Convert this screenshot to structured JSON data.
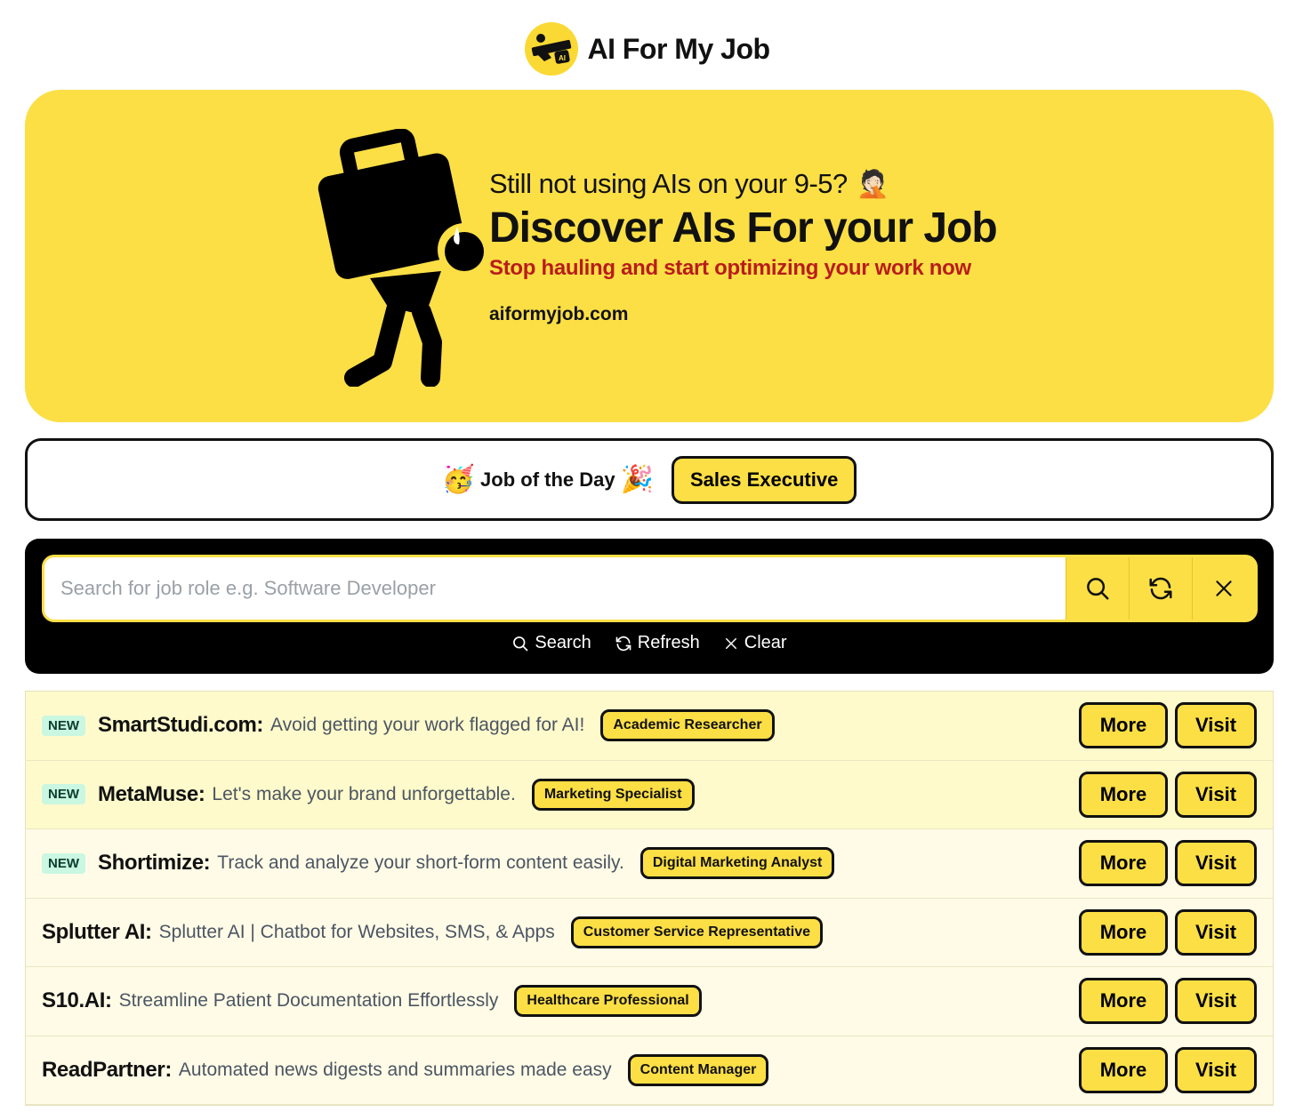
{
  "header": {
    "title": "AI For My Job",
    "logo_icon": "ai-man-carrying-icon"
  },
  "hero": {
    "kicker": "Still not using AIs on your 9-5?",
    "kicker_emoji": "🤦🏻",
    "title": "Discover AIs For your Job",
    "subtitle": "Stop hauling and start optimizing your work now",
    "url": "aiformyjob.com",
    "illustration": "person-carrying-briefcase-icon"
  },
  "job_of_day": {
    "emoji_left": "🥳",
    "label": "Job of the Day",
    "emoji_right": "🎉",
    "job": "Sales Executive"
  },
  "search": {
    "placeholder": "Search for job role e.g. Software Developer",
    "value": "",
    "search_label": "Search",
    "refresh_label": "Refresh",
    "clear_label": "Clear"
  },
  "tools": [
    {
      "is_new": true,
      "badge": "NEW",
      "name": "SmartStudi.com:",
      "desc": "Avoid getting your work flagged for AI!",
      "tag": "Academic Researcher",
      "more": "More",
      "visit": "Visit"
    },
    {
      "is_new": true,
      "badge": "NEW",
      "name": "MetaMuse:",
      "desc": "Let's make your brand unforgettable.",
      "tag": "Marketing Specialist",
      "more": "More",
      "visit": "Visit"
    },
    {
      "is_new": true,
      "badge": "NEW",
      "name": "Shortimize:",
      "desc": "Track and analyze your short-form content easily.",
      "tag": "Digital Marketing Analyst",
      "more": "More",
      "visit": "Visit"
    },
    {
      "is_new": false,
      "badge": "",
      "name": "Splutter AI:",
      "desc": "Splutter AI | Chatbot for Websites, SMS, & Apps",
      "tag": "Customer Service Representative",
      "more": "More",
      "visit": "Visit"
    },
    {
      "is_new": false,
      "badge": "",
      "name": "S10.AI:",
      "desc": "Streamline Patient Documentation Effortlessly",
      "tag": "Healthcare Professional",
      "more": "More",
      "visit": "Visit"
    },
    {
      "is_new": false,
      "badge": "",
      "name": "ReadPartner:",
      "desc": "Automated news digests and summaries made easy",
      "tag": "Content Manager",
      "more": "More",
      "visit": "Visit"
    }
  ],
  "colors": {
    "accent": "#fcdf45",
    "new_row": "#fefacb",
    "row": "#fffbe6",
    "subtitle_red": "#b91c1c",
    "new_badge": "#c9f7e2"
  }
}
